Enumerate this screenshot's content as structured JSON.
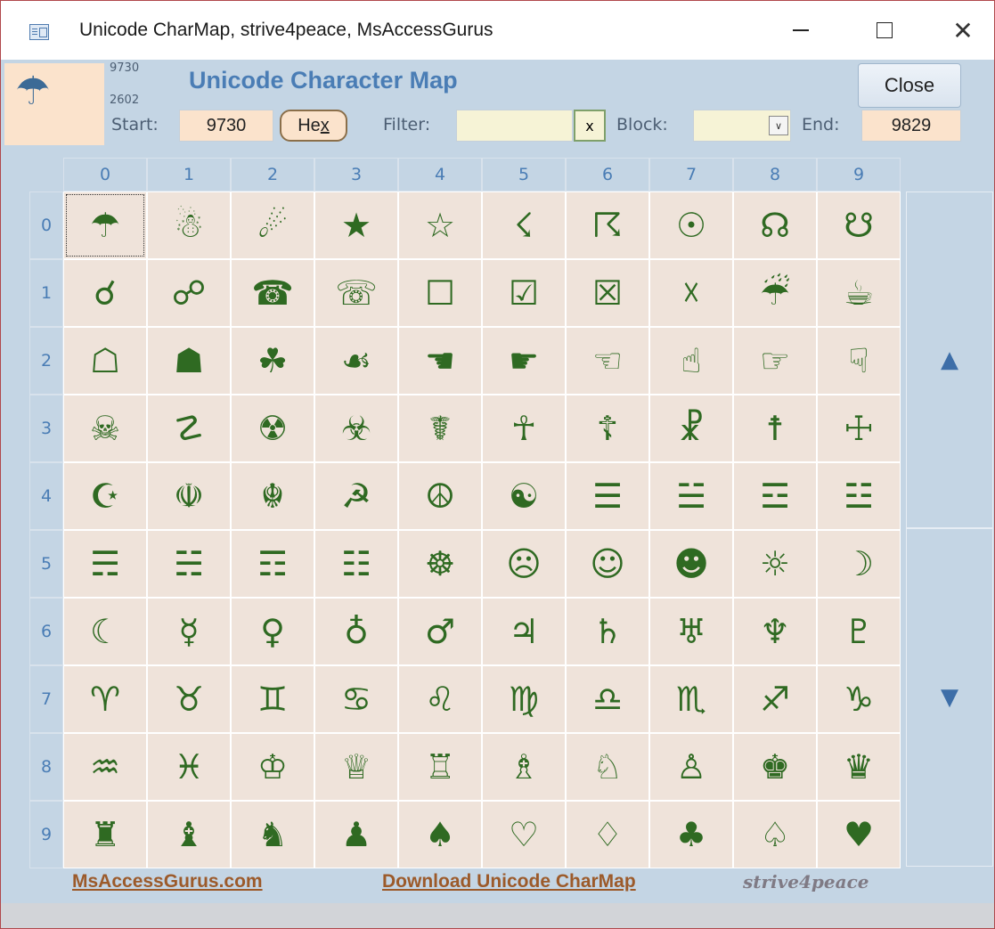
{
  "window": {
    "title": "Unicode CharMap, strive4peace, MsAccessGurus",
    "minimize_icon": "minimize-icon",
    "maximize_icon": "maximize-icon",
    "close_glyph": "✕"
  },
  "header": {
    "current_char": "☂",
    "code_decimal": "9730",
    "code_hex": "2602",
    "title": "Unicode Character Map",
    "start_label": "Start:",
    "start_value": "9730",
    "hex_button_pre": "He",
    "hex_button_underlined": "x",
    "filter_label": "Filter:",
    "filter_value": "",
    "clear_button": "x",
    "block_label": "Block:",
    "block_value": "",
    "end_label": "End:",
    "end_value": "9829",
    "close_button": "Close"
  },
  "grid": {
    "columns": [
      "0",
      "1",
      "2",
      "3",
      "4",
      "5",
      "6",
      "7",
      "8",
      "9"
    ],
    "rows": [
      "0",
      "1",
      "2",
      "3",
      "4",
      "5",
      "6",
      "7",
      "8",
      "9"
    ],
    "chars": [
      [
        "☂",
        "☃",
        "☄",
        "★",
        "☆",
        "☇",
        "☈",
        "☉",
        "☊",
        "☋"
      ],
      [
        "☌",
        "☍",
        "☎",
        "☏",
        "☐",
        "☑",
        "☒",
        "☓",
        "☔",
        "☕"
      ],
      [
        "☖",
        "☗",
        "☘",
        "☙",
        "☚",
        "☛",
        "☜",
        "☝",
        "☞",
        "☟"
      ],
      [
        "☠",
        "☡",
        "☢",
        "☣",
        "☤",
        "☥",
        "☦",
        "☧",
        "☨",
        "☩"
      ],
      [
        "☪",
        "☫",
        "☬",
        "☭",
        "☮",
        "☯",
        "☰",
        "☱",
        "☲",
        "☳"
      ],
      [
        "☴",
        "☵",
        "☶",
        "☷",
        "☸",
        "☹",
        "☺",
        "☻",
        "☼",
        "☽"
      ],
      [
        "☾",
        "☿",
        "♀",
        "♁",
        "♂",
        "♃",
        "♄",
        "♅",
        "♆",
        "♇"
      ],
      [
        "♈",
        "♉",
        "♊",
        "♋",
        "♌",
        "♍",
        "♎",
        "♏",
        "♐",
        "♑"
      ],
      [
        "♒",
        "♓",
        "♔",
        "♕",
        "♖",
        "♗",
        "♘",
        "♙",
        "♚",
        "♛"
      ],
      [
        "♜",
        "♝",
        "♞",
        "♟",
        "♠",
        "♡",
        "♢",
        "♣",
        "♤",
        "♥"
      ]
    ],
    "selected": [
      0,
      0
    ],
    "scroll_up": "▲",
    "scroll_down": "▼"
  },
  "footer": {
    "link_site": "MsAccessGurus.com",
    "link_download": "Download Unicode CharMap",
    "brand": "strive4peace"
  },
  "colors": {
    "accent": "#4a7db5",
    "glyph": "#2f6a22",
    "cell_bg": "#efe3da",
    "form_bg": "#c4d5e4",
    "link": "#9c5a2a"
  }
}
